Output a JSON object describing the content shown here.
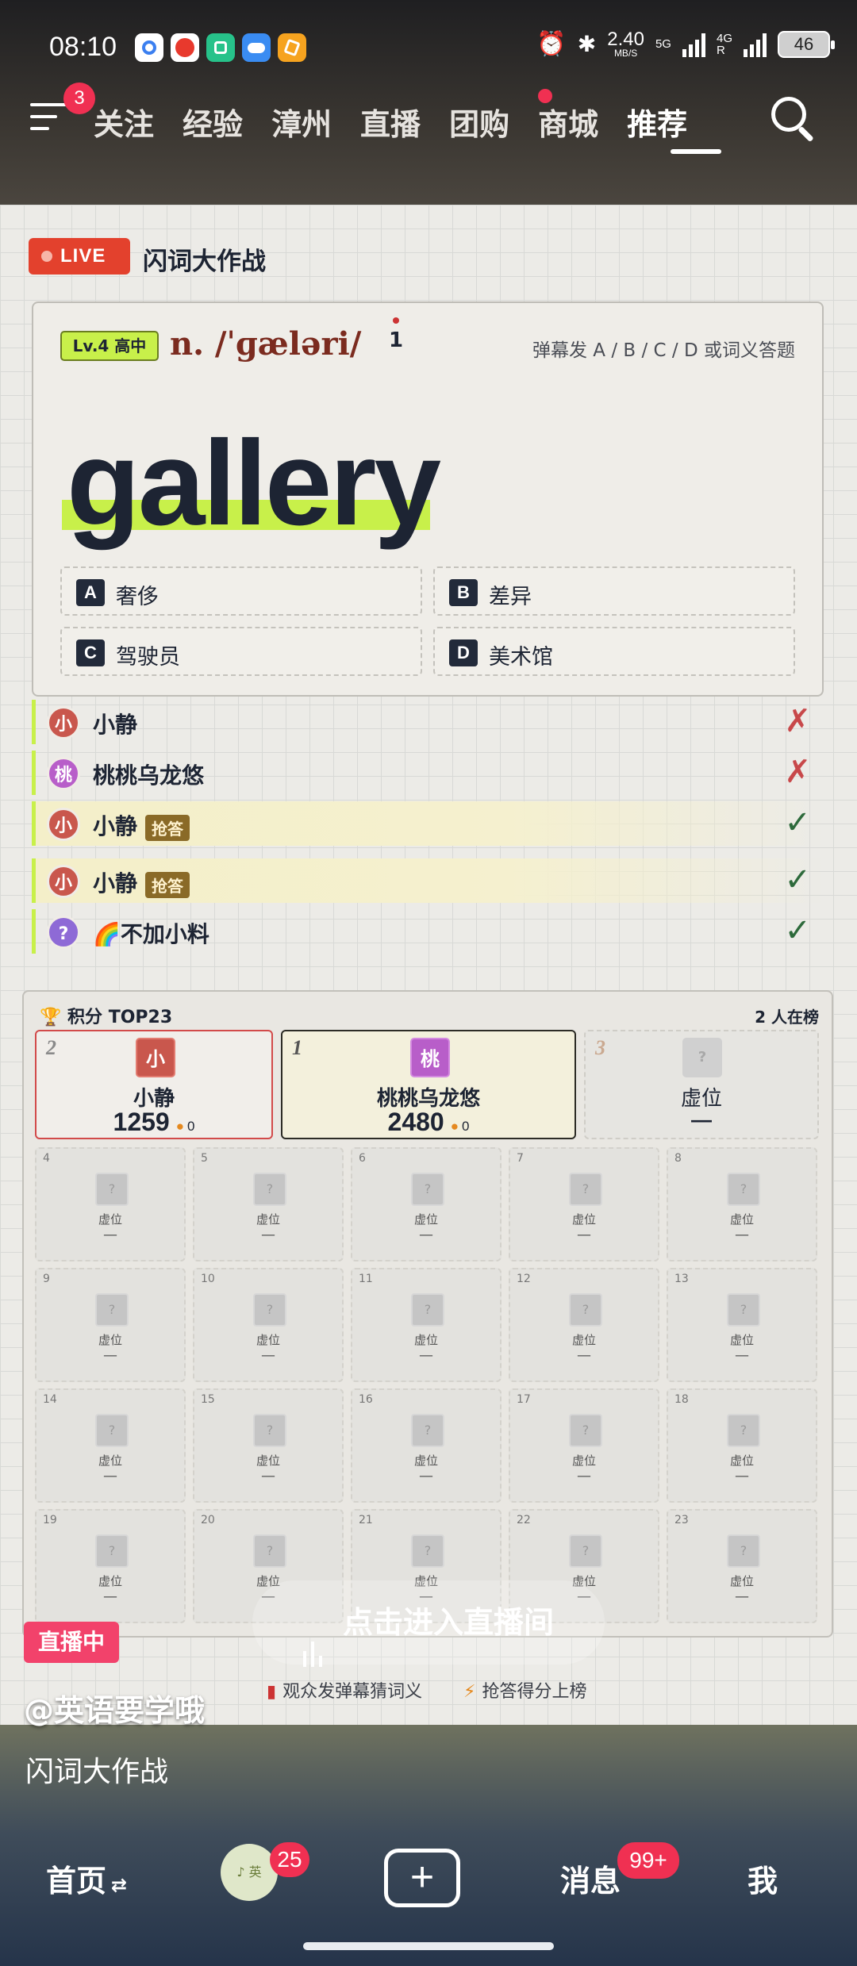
{
  "status_bar": {
    "time": "08:10",
    "net_speed_value": "2.40",
    "net_speed_unit": "MB/S",
    "sim1": "5G",
    "sim2_top": "4G",
    "sim2_bottom": "R",
    "battery": "46",
    "app_icons": [
      "app-icon-1",
      "app-icon-2",
      "app-icon-3",
      "app-icon-4",
      "app-icon-5"
    ]
  },
  "top_nav": {
    "menu_badge": "3",
    "tabs": [
      "关注",
      "经验",
      "漳州",
      "直播",
      "团购",
      "商城",
      "推荐"
    ],
    "active_tab": "推荐"
  },
  "live": {
    "badge": "LIVE",
    "title": "闪词大作战",
    "card": {
      "level": "Lv.4 高中",
      "phonetic": "n. /ˈɡæləri/",
      "index": "1",
      "hint": "弹幕发 A / B / C / D 或词义答题",
      "word": "gallery",
      "options": [
        {
          "key": "A",
          "text": "奢侈"
        },
        {
          "key": "B",
          "text": "差异"
        },
        {
          "key": "C",
          "text": "驾驶员"
        },
        {
          "key": "D",
          "text": "美术馆"
        }
      ]
    },
    "answers": [
      {
        "avatar": "小",
        "name": "小静",
        "tag": "",
        "result": "✗",
        "color": "#c9574d"
      },
      {
        "avatar": "桃",
        "name": "桃桃乌龙悠",
        "tag": "",
        "result": "✗",
        "color": "#b85ec9"
      },
      {
        "avatar": "小",
        "name": "小静",
        "tag": "抢答",
        "result": "✓",
        "color": "#c9574d"
      },
      {
        "avatar": "小",
        "name": "小静",
        "tag": "抢答",
        "result": "✓",
        "color": "#c9574d"
      },
      {
        "avatar": "?",
        "name": "🌈不加小料",
        "tag": "",
        "result": "✓",
        "color": "#8e6ad6"
      }
    ],
    "leaderboard": {
      "title": "🏆 积分 TOP23",
      "count": "2 人在榜",
      "top3": [
        {
          "rank": "2",
          "avatar": "小",
          "name": "小静",
          "score": "1259",
          "fire": "0"
        },
        {
          "rank": "1",
          "avatar": "桃",
          "name": "桃桃乌龙悠",
          "score": "2480",
          "fire": "0"
        },
        {
          "rank": "3",
          "avatar": "?",
          "name": "虚位",
          "score": "—"
        }
      ],
      "slots": [
        {
          "n": "4"
        },
        {
          "n": "5"
        },
        {
          "n": "6"
        },
        {
          "n": "7"
        },
        {
          "n": "8"
        },
        {
          "n": "9"
        },
        {
          "n": "10"
        },
        {
          "n": "11"
        },
        {
          "n": "12"
        },
        {
          "n": "13"
        },
        {
          "n": "14"
        },
        {
          "n": "15"
        },
        {
          "n": "16"
        },
        {
          "n": "17"
        },
        {
          "n": "18"
        },
        {
          "n": "19"
        },
        {
          "n": "20"
        },
        {
          "n": "21"
        },
        {
          "n": "22"
        },
        {
          "n": "23"
        }
      ],
      "slot_label": "虚位",
      "slot_dash": "—",
      "slot_q": "?"
    },
    "enter_button": "点击进入直播间",
    "live_pill": "直播中",
    "tip1": "观众发弹幕猜词义",
    "tip2": "抢答得分上榜"
  },
  "post": {
    "author": "@英语要学哦",
    "description": "闪词大作战"
  },
  "bottom_nav": {
    "home": "首页",
    "home_suffix": "⇄",
    "avatar_badge": "25",
    "messages": "消息",
    "messages_badge": "99+",
    "me": "我"
  }
}
